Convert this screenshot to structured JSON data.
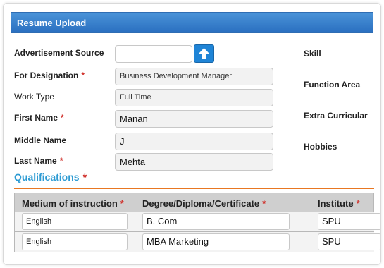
{
  "header": {
    "title": "Resume Upload"
  },
  "form": {
    "advertisement_source": {
      "label": "Advertisement Source",
      "value": ""
    },
    "designation": {
      "label": "For Designation",
      "required_mark": "*",
      "value": "Business Development Manager"
    },
    "work_type": {
      "label": "Work Type",
      "value": "Full Time"
    },
    "first_name": {
      "label": "First Name",
      "required_mark": "*",
      "value": "Manan"
    },
    "middle_name": {
      "label": "Middle Name",
      "value": "J"
    },
    "last_name": {
      "label": "Last Name",
      "required_mark": "*",
      "value": "Mehta"
    }
  },
  "right_labels": {
    "skill": "Skill",
    "function_area": "Function Area",
    "extra_curricular": "Extra Curricular",
    "hobbies": "Hobbies"
  },
  "qualifications": {
    "title": "Qualifications",
    "required_mark": "*",
    "columns": [
      {
        "label": "Medium of instruction",
        "required_mark": "*"
      },
      {
        "label": "Degree/Diploma/Certificate",
        "required_mark": "*"
      },
      {
        "label": "Institute",
        "required_mark": "*"
      }
    ],
    "rows": [
      {
        "medium": "English",
        "degree": "B. Com",
        "institute": "SPU"
      },
      {
        "medium": "English",
        "degree": "MBA Marketing",
        "institute": "SPU"
      }
    ]
  },
  "icons": {
    "upload": "upload-arrow-icon"
  },
  "colors": {
    "header_bg": "#2a6fc0",
    "accent": "#2d9bd3",
    "divider": "#e87722",
    "required": "#d0302a",
    "upload_button": "#1f84d6"
  }
}
